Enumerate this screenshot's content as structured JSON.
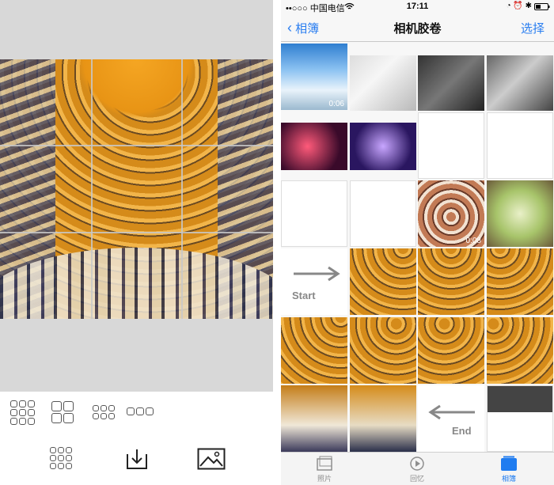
{
  "status_bar": {
    "carrier": "••○○○ 中国电信",
    "wifi_icon": "wifi-icon",
    "time": "17:11"
  },
  "nav": {
    "back_label": "相簿",
    "title": "相机胶卷",
    "select_label": "选择"
  },
  "thumbnails": {
    "video_1_duration": "0:06",
    "video_2_duration": "0:08",
    "start_label": "Start",
    "end_label": "End"
  },
  "tabs": [
    {
      "label": "照片",
      "icon": "photos-tab-icon"
    },
    {
      "label": "回忆",
      "icon": "memories-tab-icon"
    },
    {
      "label": "相簿",
      "icon": "albums-tab-icon",
      "active": true
    }
  ],
  "left_toolbar": {
    "layouts": [
      "3x3",
      "2x2",
      "3x2",
      "3x1"
    ],
    "actions": [
      "grid-icon",
      "download-icon",
      "image-icon"
    ]
  },
  "colors": {
    "accent": "#2a7ef0",
    "dome_gold": "#e8a02a",
    "tab_active": "#1f7cf0"
  }
}
